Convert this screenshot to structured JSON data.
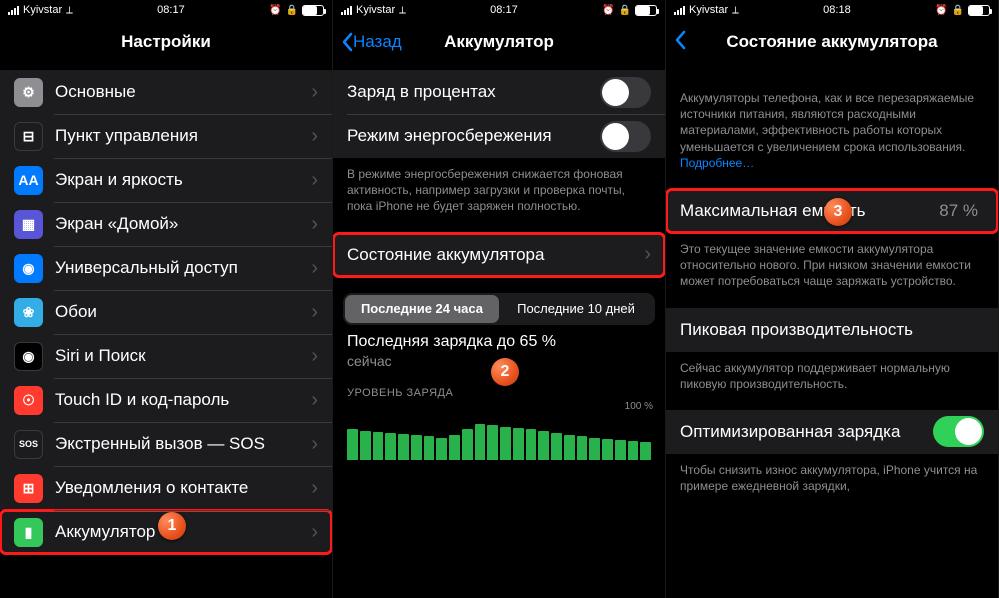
{
  "status": {
    "carrier": "Kyivstar",
    "time1": "08:17",
    "time2": "08:17",
    "time3": "08:18"
  },
  "p1": {
    "title": "Настройки",
    "items": [
      {
        "label": "Основные",
        "icon": "⚙︎",
        "bg": "bg-gray"
      },
      {
        "label": "Пункт управления",
        "icon": "⊟",
        "bg": "bg-dark"
      },
      {
        "label": "Экран и яркость",
        "icon": "AA",
        "bg": "bg-blue"
      },
      {
        "label": "Экран «Домой»",
        "icon": "▦",
        "bg": "bg-purple"
      },
      {
        "label": "Универсальный доступ",
        "icon": "◉",
        "bg": "bg-blue"
      },
      {
        "label": "Обои",
        "icon": "❀",
        "bg": "bg-cyan"
      },
      {
        "label": "Siri и Поиск",
        "icon": "◉",
        "bg": "bg-black"
      },
      {
        "label": "Touch ID и код-пароль",
        "icon": "☉",
        "bg": "bg-red"
      },
      {
        "label": "Экстренный вызов — SOS",
        "icon": "SOS",
        "bg": "bg-sos"
      },
      {
        "label": "Уведомления о контакте",
        "icon": "⊞",
        "bg": "bg-redpat"
      },
      {
        "label": "Аккумулятор",
        "icon": "▮",
        "bg": "bg-green"
      }
    ]
  },
  "p2": {
    "back": "Назад",
    "title": "Аккумулятор",
    "row_percent": "Заряд в процентах",
    "row_lowpower": "Режим энергосбережения",
    "lowpower_note": "В режиме энергосбережения снижается фоновая активность, например загрузки и проверка почты, пока iPhone не будет заряжен полностью.",
    "row_health": "Состояние аккумулятора",
    "seg_a": "Последние 24 часа",
    "seg_b": "Последние 10 дней",
    "last_charge": "Последняя зарядка до 65 %",
    "last_when": "сейчас",
    "chart_caption": "УРОВЕНЬ ЗАРЯДА"
  },
  "p3": {
    "title": "Состояние аккумулятора",
    "intro": "Аккумуляторы телефона, как и все перезаряжаемые источники питания, являются расходными материалами, эффективность работы которых уменьшается с увеличением срока использования. ",
    "intro_link": "Подробнее…",
    "row_capacity": "Максимальная емкость",
    "capacity_val": "87 %",
    "capacity_note": "Это текущее значение емкости аккумулятора относительно нового. При низком значении емкости может потребоваться чаще заряжать устройство.",
    "row_peak": "Пиковая производительность",
    "peak_note": "Сейчас аккумулятор поддерживает нормальную пиковую производительность.",
    "row_opt": "Оптимизированная зарядка",
    "opt_note": "Чтобы снизить износ аккумулятора, iPhone учится на примере ежедневной зарядки, "
  },
  "badges": {
    "b1": "1",
    "b2": "2",
    "b3": "3"
  },
  "chart_data": {
    "type": "bar",
    "title": "Последняя зарядка до 65 %",
    "caption": "УРОВЕНЬ ЗАРЯДА",
    "ylim": [
      0,
      100
    ],
    "values": [
      55,
      52,
      50,
      48,
      46,
      44,
      42,
      40,
      45,
      55,
      65,
      63,
      60,
      58,
      55,
      52,
      48,
      45,
      42,
      40,
      38,
      36,
      34,
      32
    ]
  }
}
